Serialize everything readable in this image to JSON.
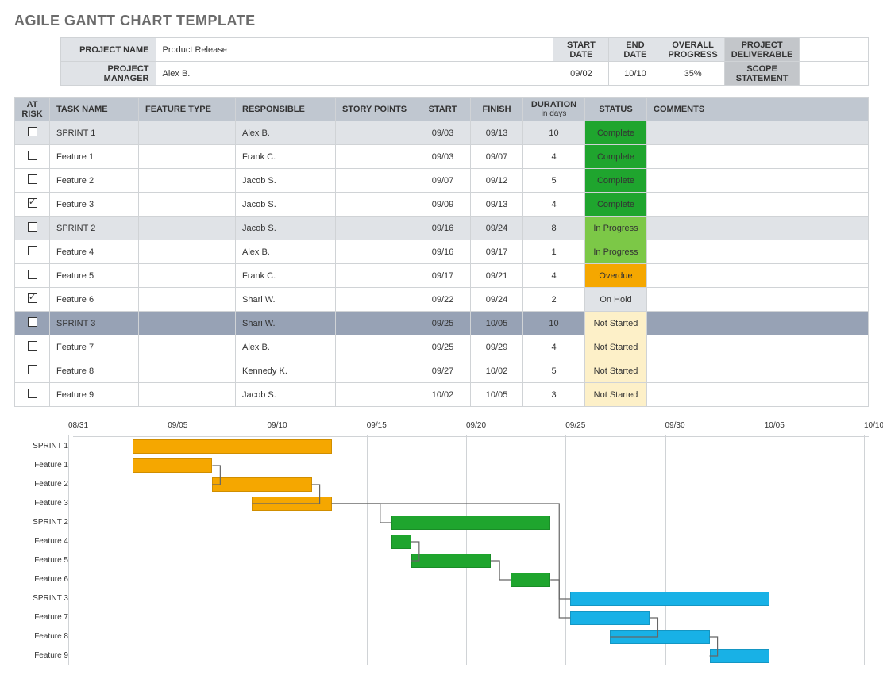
{
  "title": "AGILE GANTT CHART TEMPLATE",
  "meta": {
    "labels": {
      "project_name": "PROJECT NAME",
      "project_manager": "PROJECT MANAGER",
      "start_date": "START DATE",
      "end_date": "END DATE",
      "overall_progress": "OVERALL PROGRESS",
      "project_deliverable": "PROJECT DELIVERABLE",
      "scope_statement": "SCOPE STATEMENT"
    },
    "project_name": "Product Release",
    "project_manager": "Alex B.",
    "start_date": "09/02",
    "end_date": "10/10",
    "overall_progress": "35%",
    "project_deliverable": "",
    "scope_statement": ""
  },
  "columns": {
    "at_risk": "AT RISK",
    "task_name": "TASK NAME",
    "feature_type": "FEATURE TYPE",
    "responsible": "RESPONSIBLE",
    "story_points": "STORY POINTS",
    "start": "START",
    "finish": "FINISH",
    "duration": "DURATION",
    "duration_sub": "in days",
    "status": "STATUS",
    "comments": "COMMENTS"
  },
  "status_colors": {
    "Complete": "#1fa52e",
    "In Progress": "#7cc847",
    "Overdue": "#f5a700",
    "On Hold": "#e0e3e7",
    "Not Started": "#fdf0c8"
  },
  "rows": [
    {
      "risk": false,
      "sprint": true,
      "name": "SPRINT 1",
      "resp": "Alex B.",
      "start": "09/03",
      "finish": "09/13",
      "dur": "10",
      "status": "Complete"
    },
    {
      "risk": false,
      "name": "Feature 1",
      "resp": "Frank C.",
      "start": "09/03",
      "finish": "09/07",
      "dur": "4",
      "status": "Complete"
    },
    {
      "risk": false,
      "name": "Feature 2",
      "resp": "Jacob S.",
      "start": "09/07",
      "finish": "09/12",
      "dur": "5",
      "status": "Complete"
    },
    {
      "risk": true,
      "name": "Feature 3",
      "resp": "Jacob S.",
      "start": "09/09",
      "finish": "09/13",
      "dur": "4",
      "status": "Complete"
    },
    {
      "risk": false,
      "sprint": true,
      "name": "SPRINT 2",
      "resp": "Jacob S.",
      "start": "09/16",
      "finish": "09/24",
      "dur": "8",
      "status": "In Progress"
    },
    {
      "risk": false,
      "name": "Feature 4",
      "resp": "Alex B.",
      "start": "09/16",
      "finish": "09/17",
      "dur": "1",
      "status": "In Progress"
    },
    {
      "risk": false,
      "name": "Feature 5",
      "resp": "Frank C.",
      "start": "09/17",
      "finish": "09/21",
      "dur": "4",
      "status": "Overdue"
    },
    {
      "risk": true,
      "name": "Feature 6",
      "resp": "Shari W.",
      "start": "09/22",
      "finish": "09/24",
      "dur": "2",
      "status": "On Hold"
    },
    {
      "risk": false,
      "sprint": true,
      "selected": true,
      "name": "SPRINT 3",
      "resp": "Shari W.",
      "start": "09/25",
      "finish": "10/05",
      "dur": "10",
      "status": "Not Started"
    },
    {
      "risk": false,
      "name": "Feature 7",
      "resp": "Alex B.",
      "start": "09/25",
      "finish": "09/29",
      "dur": "4",
      "status": "Not Started"
    },
    {
      "risk": false,
      "name": "Feature 8",
      "resp": "Kennedy K.",
      "start": "09/27",
      "finish": "10/02",
      "dur": "5",
      "status": "Not Started"
    },
    {
      "risk": false,
      "name": "Feature 9",
      "resp": "Jacob S.",
      "start": "10/02",
      "finish": "10/05",
      "dur": "3",
      "status": "Not Started"
    }
  ],
  "chart_data": {
    "type": "gantt",
    "title": "",
    "xlabel": "",
    "ylabel": "",
    "x_ticks": [
      "08/31",
      "09/05",
      "09/10",
      "09/15",
      "09/20",
      "09/25",
      "09/30",
      "10/05",
      "10/10"
    ],
    "x_range_days": {
      "min": "08/31",
      "max": "10/10",
      "span": 40
    },
    "colors": {
      "sprint1": "#f5a700",
      "sprint2": "#1fa52e",
      "sprint3": "#18b1e6"
    },
    "tasks": [
      {
        "name": "SPRINT 1",
        "start": "09/03",
        "end": "09/13",
        "group": "sprint1"
      },
      {
        "name": "Feature 1",
        "start": "09/03",
        "end": "09/07",
        "group": "sprint1"
      },
      {
        "name": "Feature 2",
        "start": "09/07",
        "end": "09/12",
        "group": "sprint1"
      },
      {
        "name": "Feature 3",
        "start": "09/09",
        "end": "09/13",
        "group": "sprint1"
      },
      {
        "name": "SPRINT 2",
        "start": "09/16",
        "end": "09/24",
        "group": "sprint2"
      },
      {
        "name": "Feature 4",
        "start": "09/16",
        "end": "09/17",
        "group": "sprint2"
      },
      {
        "name": "Feature 5",
        "start": "09/17",
        "end": "09/21",
        "group": "sprint2"
      },
      {
        "name": "Feature 6",
        "start": "09/22",
        "end": "09/24",
        "group": "sprint2"
      },
      {
        "name": "SPRINT 3",
        "start": "09/25",
        "end": "10/05",
        "group": "sprint3"
      },
      {
        "name": "Feature 7",
        "start": "09/25",
        "end": "09/29",
        "group": "sprint3"
      },
      {
        "name": "Feature 8",
        "start": "09/27",
        "end": "10/02",
        "group": "sprint3"
      },
      {
        "name": "Feature 9",
        "start": "10/02",
        "end": "10/05",
        "group": "sprint3"
      }
    ],
    "dependencies": [
      {
        "from": "Feature 1",
        "to": "Feature 2"
      },
      {
        "from": "Feature 2",
        "to": "Feature 3"
      },
      {
        "from": "Feature 3",
        "to": "SPRINT 2"
      },
      {
        "from": "Feature 4",
        "to": "Feature 5"
      },
      {
        "from": "Feature 5",
        "to": "Feature 6"
      },
      {
        "from": "Feature 6",
        "to": "SPRINT 3"
      },
      {
        "from": "Feature 3",
        "to": "Feature 7"
      },
      {
        "from": "Feature 7",
        "to": "Feature 8"
      },
      {
        "from": "Feature 8",
        "to": "Feature 9"
      }
    ]
  }
}
